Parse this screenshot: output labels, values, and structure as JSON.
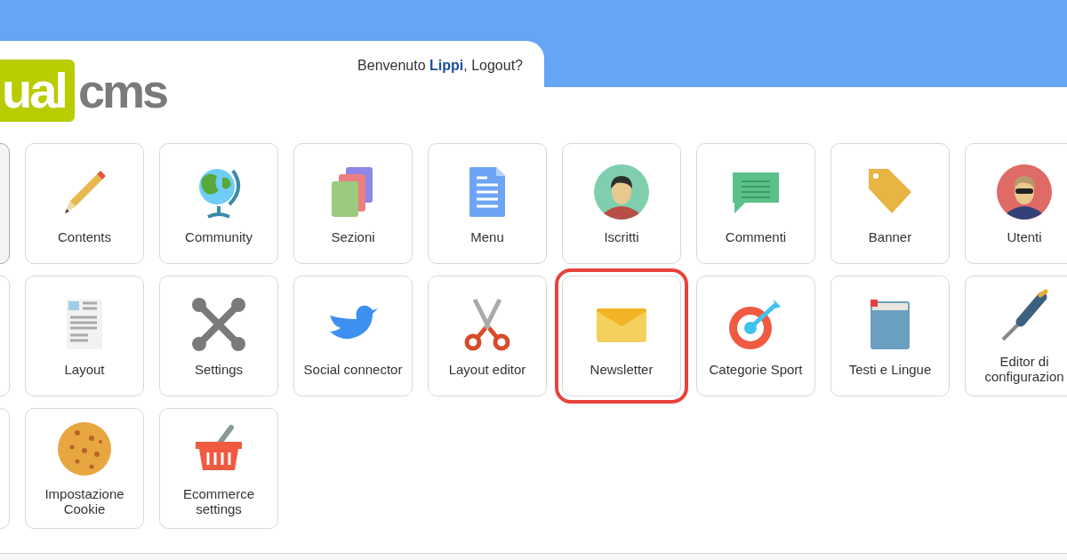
{
  "header": {
    "logo": {
      "part1": "ual",
      "part2": "cms"
    },
    "welcome": {
      "prefix": "Benvenuto",
      "user": "Lippi",
      "suffix": ", Logout?"
    }
  },
  "rows": [
    {
      "edge_tile_shaded": true,
      "tiles": [
        {
          "label": "Contents",
          "kind": "pencil",
          "highlighted": false
        },
        {
          "label": "Community",
          "kind": "globe",
          "highlighted": false
        },
        {
          "label": "Sezioni",
          "kind": "pages",
          "highlighted": false
        },
        {
          "label": "Menu",
          "kind": "document",
          "highlighted": false
        },
        {
          "label": "Iscritti",
          "kind": "avatar",
          "highlighted": false
        },
        {
          "label": "Commenti",
          "kind": "bubble",
          "highlighted": false
        },
        {
          "label": "Banner",
          "kind": "tag",
          "highlighted": false
        },
        {
          "label": "Utenti",
          "kind": "avatar-glasses",
          "highlighted": false
        }
      ]
    },
    {
      "edge_tile_shaded": false,
      "tiles": [
        {
          "label": "Layout",
          "kind": "layout",
          "highlighted": false
        },
        {
          "label": "Settings",
          "kind": "wrenches",
          "highlighted": false
        },
        {
          "label": "Social connector",
          "kind": "bird",
          "highlighted": false
        },
        {
          "label": "Layout editor",
          "kind": "scissors",
          "highlighted": false
        },
        {
          "label": "Newsletter",
          "kind": "envelope",
          "highlighted": true
        },
        {
          "label": "Categorie Sport",
          "kind": "target",
          "highlighted": false
        },
        {
          "label": "Testi e Lingue",
          "kind": "book",
          "highlighted": false
        },
        {
          "label": "Editor di configurazion",
          "kind": "screwdriver",
          "highlighted": false
        }
      ]
    },
    {
      "edge_tile_shaded": false,
      "tiles": [
        {
          "label": "Impostazione Cookie",
          "kind": "cookie",
          "highlighted": false
        },
        {
          "label": "Ecommerce settings",
          "kind": "basket",
          "highlighted": false
        }
      ]
    }
  ]
}
